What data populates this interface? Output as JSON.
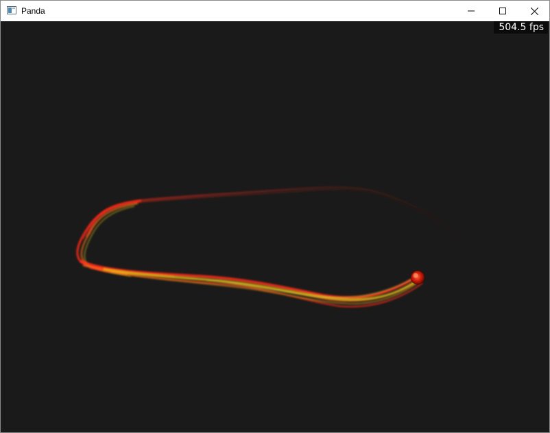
{
  "window": {
    "title": "Panda",
    "icon": "app-window-icon",
    "controls": {
      "minimize": "minimize-icon",
      "maximize": "maximize-icon",
      "close": "close-icon"
    }
  },
  "viewport": {
    "background": "#1a1a1a",
    "fps_label": "504.5 fps"
  },
  "colors": {
    "trail_red": "#ff2a1a",
    "trail_orange": "#ff7a18",
    "trail_yellow": "#d8d21a",
    "head_dark_red": "#8a0c06"
  }
}
